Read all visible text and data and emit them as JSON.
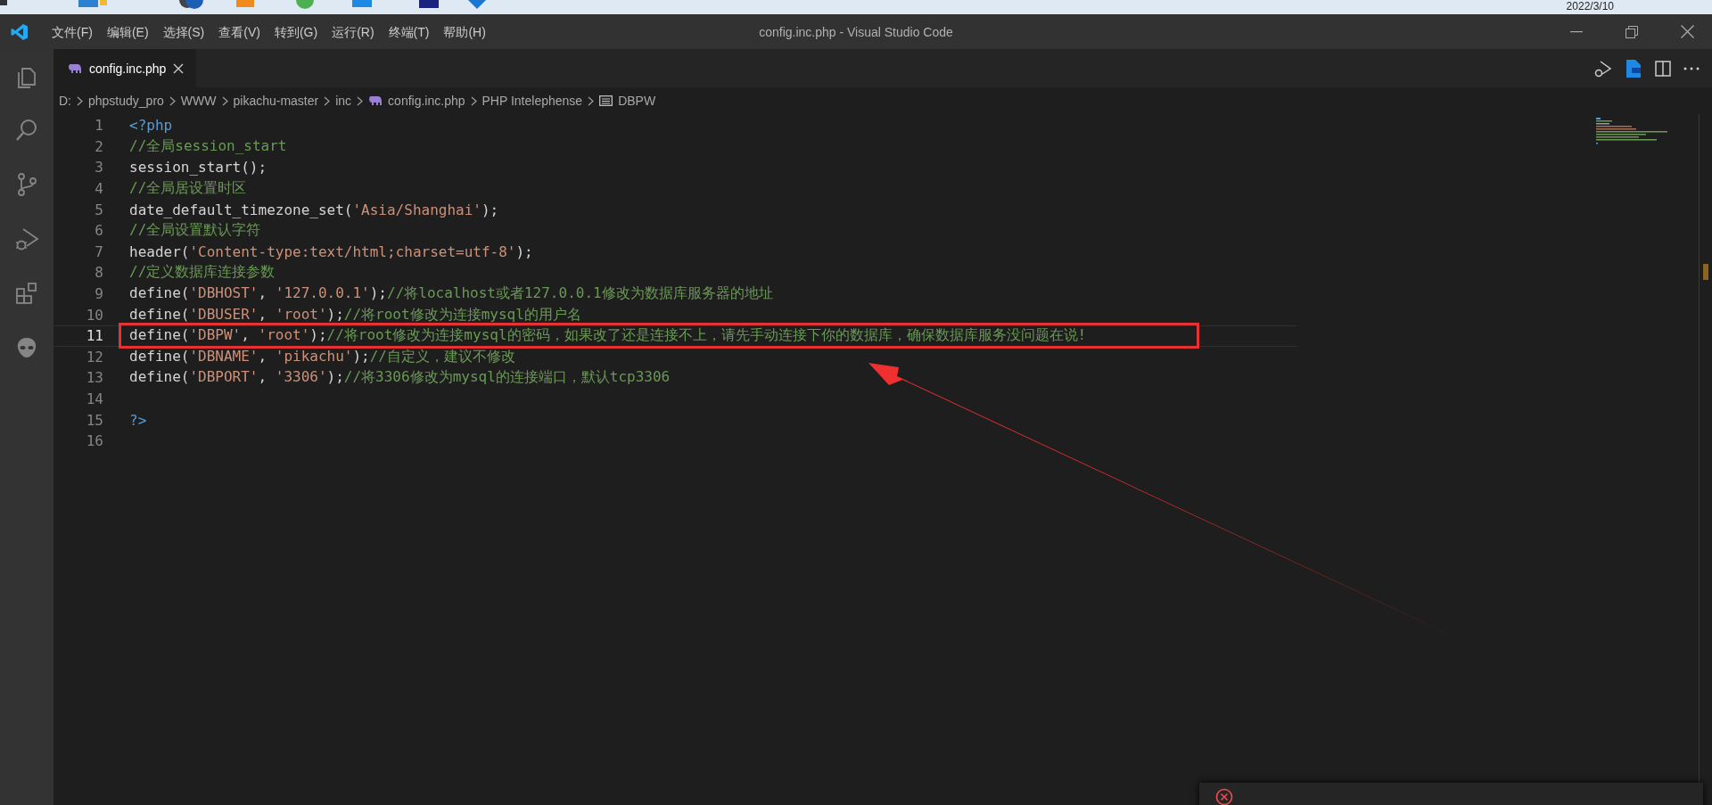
{
  "taskbar": {
    "date": "2022/3/10"
  },
  "window": {
    "title": "config.inc.php - Visual Studio Code"
  },
  "menu": [
    "文件(F)",
    "编辑(E)",
    "选择(S)",
    "查看(V)",
    "转到(G)",
    "运行(R)",
    "终端(T)",
    "帮助(H)"
  ],
  "tabs": [
    {
      "label": "config.inc.php",
      "selected": true
    }
  ],
  "breadcrumb": [
    {
      "label": "D:",
      "kind": "folder"
    },
    {
      "label": "phpstudy_pro",
      "kind": "folder"
    },
    {
      "label": "WWW",
      "kind": "folder"
    },
    {
      "label": "pikachu-master",
      "kind": "folder"
    },
    {
      "label": "inc",
      "kind": "folder"
    },
    {
      "label": "config.inc.php",
      "kind": "file"
    },
    {
      "label": "PHP Intelephense",
      "kind": "folder"
    },
    {
      "label": "DBPW",
      "kind": "symbol"
    }
  ],
  "editor": {
    "lines": [
      {
        "number": "1",
        "selected": false,
        "tokens": [
          {
            "kind": "tag",
            "text": "<?php"
          }
        ]
      },
      {
        "number": "2",
        "selected": false,
        "tokens": [
          {
            "kind": "comment",
            "text": "//全局session_start"
          }
        ]
      },
      {
        "number": "3",
        "selected": false,
        "tokens": [
          {
            "kind": "plain",
            "text": "session_start();"
          }
        ]
      },
      {
        "number": "4",
        "selected": false,
        "tokens": [
          {
            "kind": "comment",
            "text": "//全局居设置时区"
          }
        ]
      },
      {
        "number": "5",
        "selected": false,
        "tokens": [
          {
            "kind": "plain",
            "text": "date_default_timezone_set("
          },
          {
            "kind": "string",
            "text": "'Asia/Shanghai'"
          },
          {
            "kind": "plain",
            "text": ");"
          }
        ]
      },
      {
        "number": "6",
        "selected": false,
        "tokens": [
          {
            "kind": "comment",
            "text": "//全局设置默认字符"
          }
        ]
      },
      {
        "number": "7",
        "selected": false,
        "tokens": [
          {
            "kind": "plain",
            "text": "header("
          },
          {
            "kind": "string",
            "text": "'Content-type:text/html;charset=utf-8'"
          },
          {
            "kind": "plain",
            "text": ");"
          }
        ]
      },
      {
        "number": "8",
        "selected": false,
        "tokens": [
          {
            "kind": "comment",
            "text": "//定义数据库连接参数"
          }
        ]
      },
      {
        "number": "9",
        "selected": false,
        "tokens": [
          {
            "kind": "plain",
            "text": "define("
          },
          {
            "kind": "string",
            "text": "'DBHOST'"
          },
          {
            "kind": "plain",
            "text": ", "
          },
          {
            "kind": "string",
            "text": "'127.0.0.1'"
          },
          {
            "kind": "plain",
            "text": ");"
          },
          {
            "kind": "comment",
            "text": "//将localhost或者127.0.0.1修改为数据库服务器的地址"
          }
        ]
      },
      {
        "number": "10",
        "selected": false,
        "tokens": [
          {
            "kind": "plain",
            "text": "define("
          },
          {
            "kind": "string",
            "text": "'DBUSER'"
          },
          {
            "kind": "plain",
            "text": ", "
          },
          {
            "kind": "string",
            "text": "'root'"
          },
          {
            "kind": "plain",
            "text": ");"
          },
          {
            "kind": "comment",
            "text": "//将root修改为连接mysql的用户名"
          }
        ]
      },
      {
        "number": "11",
        "selected": true,
        "tokens": [
          {
            "kind": "plain",
            "text": "define("
          },
          {
            "kind": "string",
            "text": "'DBPW'"
          },
          {
            "kind": "plain",
            "text": ", "
          },
          {
            "kind": "string",
            "text": "'root'"
          },
          {
            "kind": "plain",
            "text": ");"
          },
          {
            "kind": "comment",
            "text": "//将root修改为连接mysql的密码，如果改了还是连接不上，请先手动连接下你的数据库，确保数据库服务没问题在说!"
          }
        ]
      },
      {
        "number": "12",
        "selected": false,
        "tokens": [
          {
            "kind": "plain",
            "text": "define("
          },
          {
            "kind": "string",
            "text": "'DBNAME'"
          },
          {
            "kind": "plain",
            "text": ", "
          },
          {
            "kind": "string",
            "text": "'pikachu'"
          },
          {
            "kind": "plain",
            "text": ");"
          },
          {
            "kind": "comment",
            "text": "//自定义，建议不修改"
          }
        ]
      },
      {
        "number": "13",
        "selected": false,
        "tokens": [
          {
            "kind": "plain",
            "text": "define("
          },
          {
            "kind": "string",
            "text": "'DBPORT'"
          },
          {
            "kind": "plain",
            "text": ", "
          },
          {
            "kind": "string",
            "text": "'3306'"
          },
          {
            "kind": "plain",
            "text": ");"
          },
          {
            "kind": "comment",
            "text": "//将3306修改为mysql的连接端口，默认tcp3306"
          }
        ]
      },
      {
        "number": "14",
        "selected": false
      },
      {
        "number": "15",
        "selected": false,
        "tokens": [
          {
            "kind": "tag",
            "text": "?>"
          }
        ]
      },
      {
        "number": "16",
        "selected": false
      }
    ]
  },
  "notification": {
    "kind": "error"
  }
}
